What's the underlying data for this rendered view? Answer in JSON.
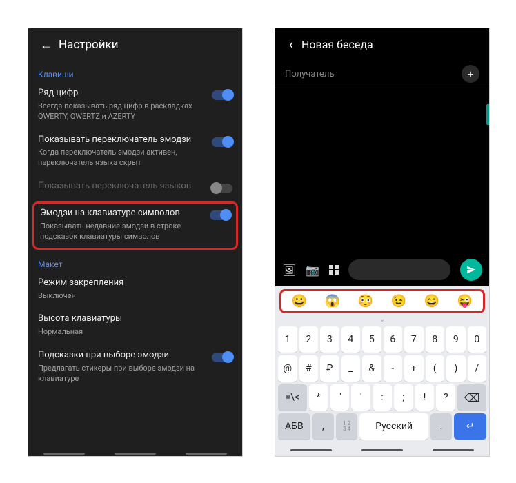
{
  "left": {
    "title": "Настройки",
    "section1": "Клавиши",
    "rows": [
      {
        "t": "Ряд цифр",
        "s": "Всегда показывать ряд цифр в раскладках QWERTY, QWERTZ и AZERTY",
        "on": true
      },
      {
        "t": "Показывать переключатель эмодзи",
        "s": "Когда переключатель эмодзи активен, переключатель языка скрыт",
        "on": true
      },
      {
        "t": "Показывать переключатель языков",
        "s": "",
        "on": false,
        "disabled": true
      },
      {
        "t": "Эмодзи на клавиатуре символов",
        "s": "Показывать недавние эмодзи в строке подсказок клавиатуры символов",
        "on": true,
        "hl": true
      }
    ],
    "section2": "Макет",
    "rows2": [
      {
        "t": "Режим закрепления",
        "s": "Выключен"
      },
      {
        "t": "Высота клавиатуры",
        "s": "Нормальная"
      },
      {
        "t": "Подсказки при выборе эмодзи",
        "s": "Предлагать стикеры при выборе эмодзи на клавиатуре",
        "on": true
      }
    ]
  },
  "right": {
    "title": "Новая беседа",
    "recipient_ph": "Получатель",
    "emojis": [
      "😀",
      "😱",
      "😳",
      "😉",
      "😄",
      "😜"
    ],
    "krow1": [
      "1",
      "2",
      "3",
      "4",
      "5",
      "6",
      "7",
      "8",
      "9",
      "0"
    ],
    "krow2": [
      "@",
      "#",
      "₽",
      "_",
      "&",
      "-",
      "+",
      "(",
      ")",
      "/"
    ],
    "krow3_lead": "=\\<",
    "krow3": [
      "*",
      "\"",
      "'",
      ":",
      ";",
      "!",
      "?"
    ],
    "abv": "АБВ",
    "comma": ",",
    "twelve": "1 2\n3 4",
    "lang": "Русский",
    "dot": "."
  }
}
